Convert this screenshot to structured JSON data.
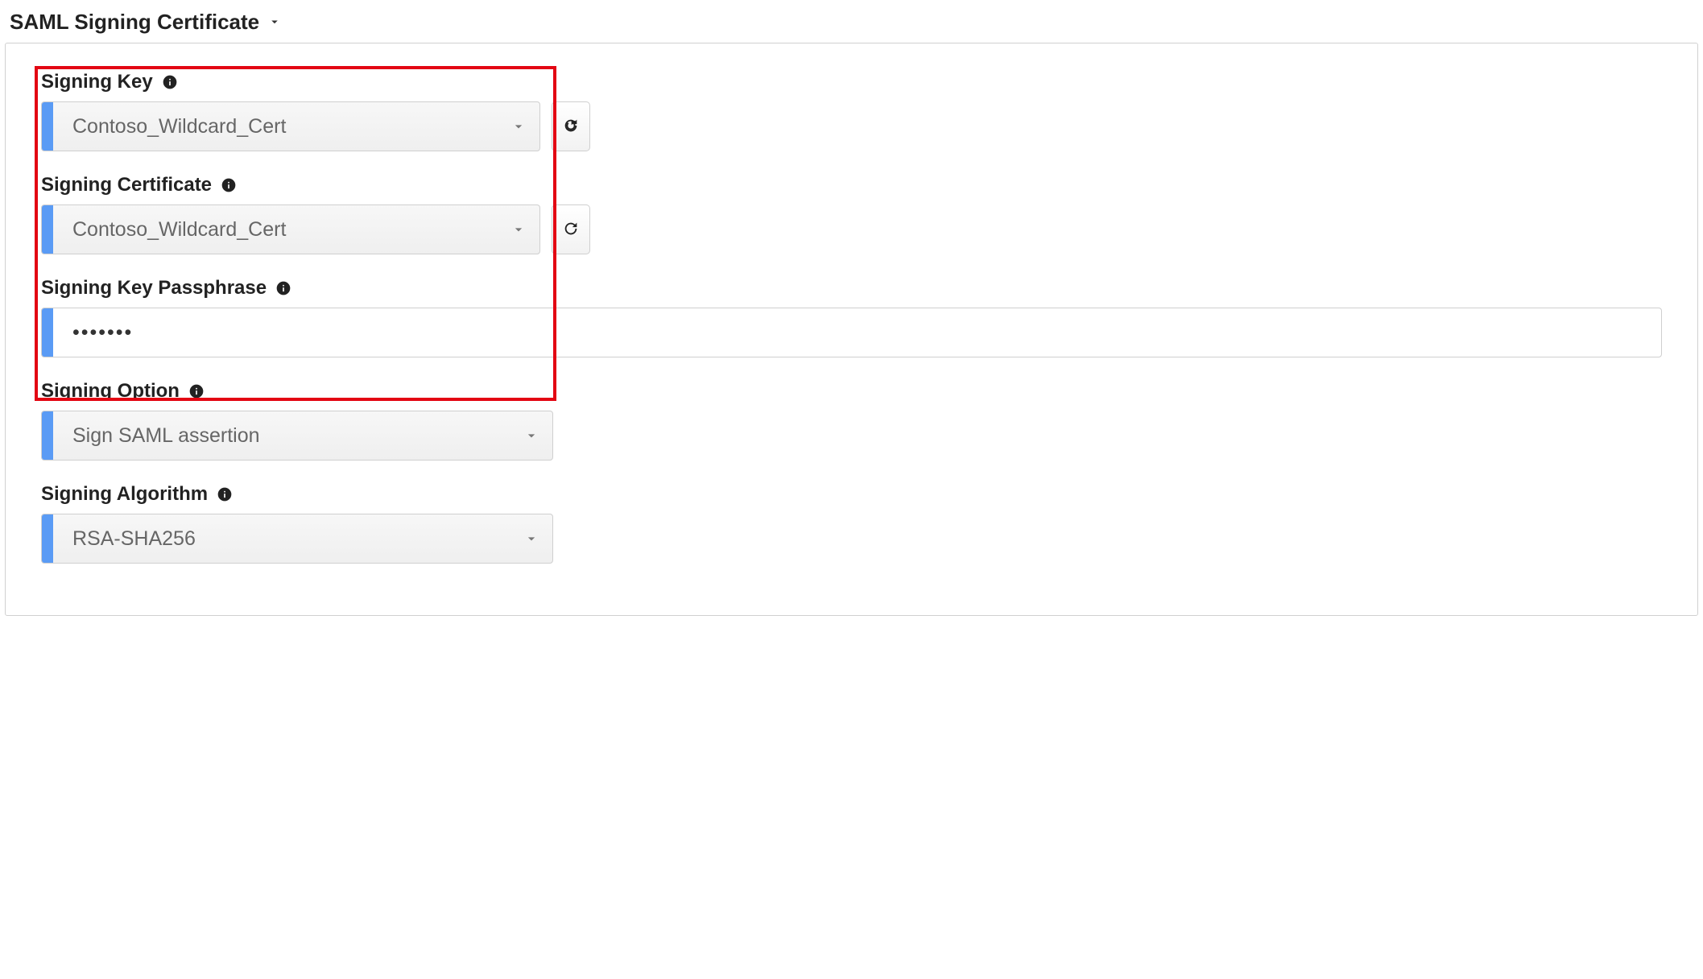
{
  "section": {
    "title": "SAML Signing Certificate"
  },
  "fields": {
    "signing_key": {
      "label": "Signing Key",
      "value": "Contoso_Wildcard_Cert"
    },
    "signing_certificate": {
      "label": "Signing Certificate",
      "value": "Contoso_Wildcard_Cert"
    },
    "signing_key_passphrase": {
      "label": "Signing Key Passphrase",
      "value": "•••••••"
    },
    "signing_option": {
      "label": "Signing Option",
      "value": "Sign SAML assertion"
    },
    "signing_algorithm": {
      "label": "Signing Algorithm",
      "value": "RSA-SHA256"
    }
  }
}
